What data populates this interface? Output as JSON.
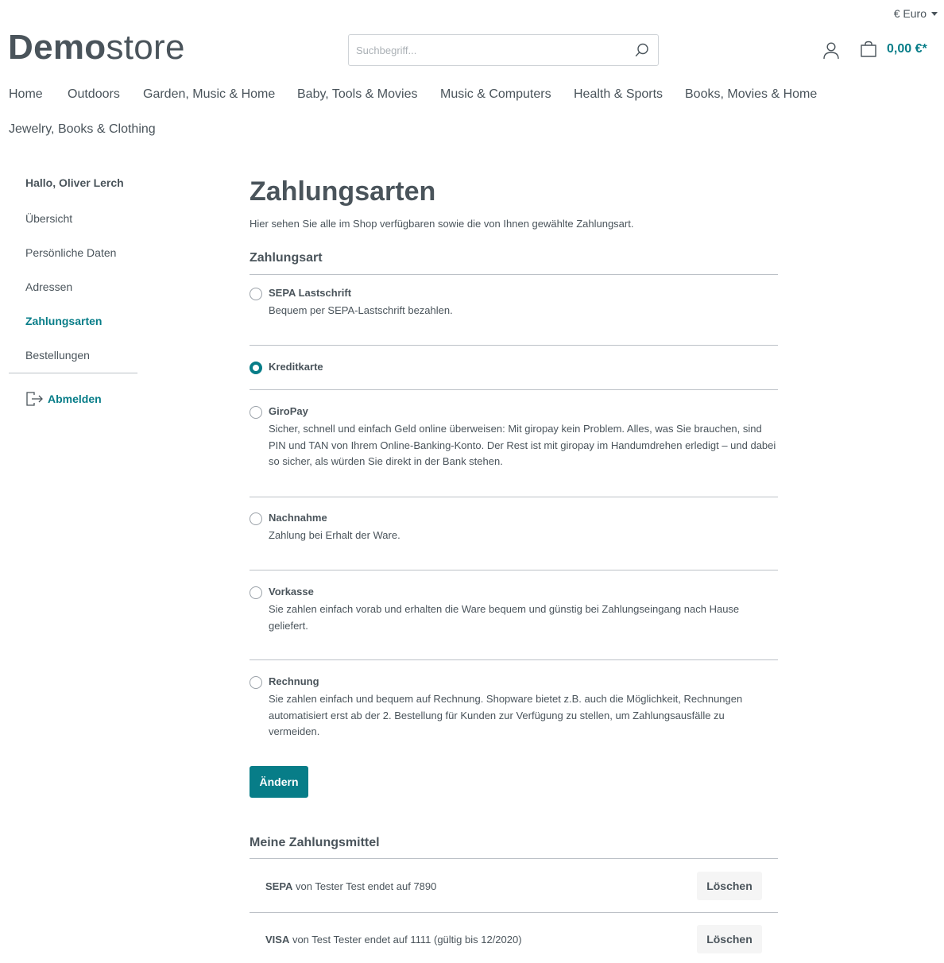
{
  "header": {
    "currency_label": "€ Euro",
    "logo_bold": "Demo",
    "logo_light": "store",
    "search_placeholder": "Suchbegriff...",
    "cart_total": "0,00 €*"
  },
  "nav": {
    "items": [
      {
        "label": "Home"
      },
      {
        "label": "Outdoors"
      },
      {
        "label": "Garden, Music & Home"
      },
      {
        "label": "Baby, Tools & Movies"
      },
      {
        "label": "Music & Computers"
      },
      {
        "label": "Health & Sports"
      },
      {
        "label": "Books, Movies & Home"
      },
      {
        "label": "Jewelry, Books & Clothing"
      }
    ]
  },
  "sidebar": {
    "greeting": "Hallo, Oliver Lerch",
    "items": [
      {
        "label": "Übersicht"
      },
      {
        "label": "Persönliche Daten"
      },
      {
        "label": "Adressen"
      },
      {
        "label": "Zahlungsarten",
        "active": true
      },
      {
        "label": "Bestellungen"
      }
    ],
    "logout_label": "Abmelden"
  },
  "main": {
    "title": "Zahlungsarten",
    "intro": "Hier sehen Sie alle im Shop verfügbaren sowie die von Ihnen gewählte Zahlungsart.",
    "section_label": "Zahlungsart",
    "payment_methods": [
      {
        "name": "SEPA Lastschrift",
        "description": "Bequem per SEPA-Lastschrift bezahlen.",
        "selected": false
      },
      {
        "name": "Kreditkarte",
        "description": "",
        "selected": true
      },
      {
        "name": "GiroPay",
        "description": "Sicher, schnell und einfach Geld online überweisen: Mit giropay kein Problem. Alles, was Sie brauchen, sind PIN und TAN von Ihrem Online-Banking-Konto. Der Rest ist mit giropay im Handumdrehen erledigt – und dabei so sicher, als würden Sie direkt in der Bank stehen.",
        "selected": false
      },
      {
        "name": "Nachnahme",
        "description": "Zahlung bei Erhalt der Ware.",
        "selected": false
      },
      {
        "name": "Vorkasse",
        "description": "Sie zahlen einfach vorab und erhalten die Ware bequem und günstig bei Zahlungseingang nach Hause geliefert.",
        "selected": false
      },
      {
        "name": "Rechnung",
        "description": "Sie zahlen einfach und bequem auf Rechnung. Shopware bietet z.B. auch die Möglichkeit, Rechnungen automatisiert erst ab der 2. Bestellung für Kunden zur Verfügung zu stellen, um Zahlungsausfälle zu vermeiden.",
        "selected": false
      }
    ],
    "change_button": "Ändern",
    "saved_title": "Meine Zahlungsmittel",
    "saved": [
      {
        "type": "SEPA",
        "text": " von Tester Test endet auf 7890",
        "delete_label": "Löschen"
      },
      {
        "type": "VISA",
        "text": " von Test Tester endet auf 1111 (gültig bis 12/2020)",
        "delete_label": "Löschen"
      }
    ]
  },
  "colors": {
    "accent": "#077d88",
    "text": "#4a545b",
    "divider": "#bcc1c7"
  }
}
